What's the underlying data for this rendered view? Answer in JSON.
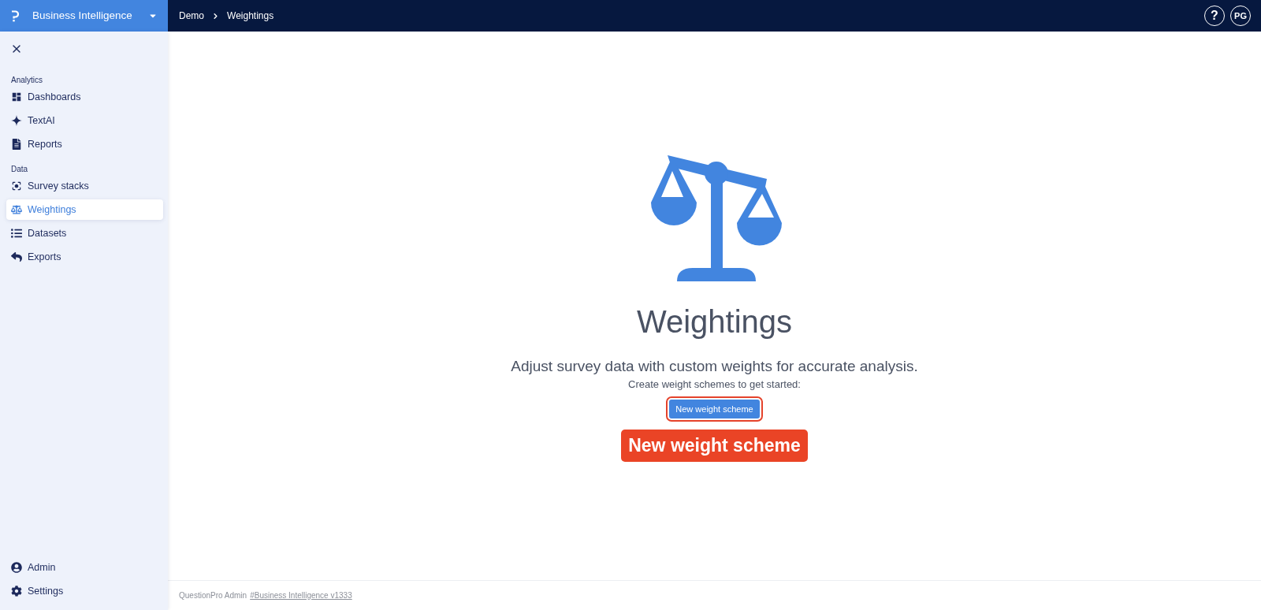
{
  "header": {
    "app_switcher": {
      "label": "Business Intelligence"
    },
    "breadcrumb": [
      {
        "label": "Demo"
      },
      {
        "label": "Weightings"
      }
    ],
    "help_button": {
      "label": "?"
    },
    "user_avatar": {
      "initials": "PG"
    }
  },
  "sidebar": {
    "groups": [
      {
        "heading": "Analytics",
        "items": [
          {
            "label": "Dashboards",
            "selected": false
          },
          {
            "label": "TextAI",
            "selected": false
          },
          {
            "label": "Reports",
            "selected": false
          }
        ]
      },
      {
        "heading": "Data",
        "items": [
          {
            "label": "Survey stacks",
            "selected": false
          },
          {
            "label": "Weightings",
            "selected": true
          },
          {
            "label": "Datasets",
            "selected": false
          },
          {
            "label": "Exports",
            "selected": false
          }
        ]
      }
    ],
    "bottom_items": [
      {
        "label": "Admin",
        "selected": false
      },
      {
        "label": "Settings",
        "selected": false
      }
    ]
  },
  "empty_state": {
    "title": "Weightings",
    "description": "Adjust survey data with custom weights for accurate analysis.",
    "prompt": "Create weight schemes to get started:",
    "button": {
      "label": "New weight scheme",
      "highlighted": true
    }
  },
  "callout": {
    "label": "New weight scheme"
  },
  "footer": {
    "text": "QuestionPro Admin",
    "link": "#Business Intelligence v1333"
  }
}
